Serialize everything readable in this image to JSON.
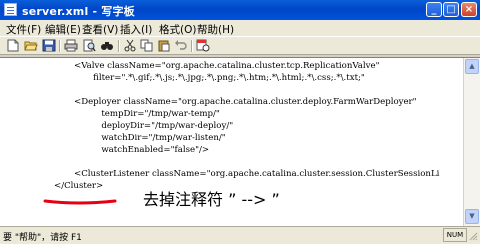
{
  "window": {
    "title": "server.xml - 写字板"
  },
  "titlebar_buttons": {
    "minimize": "_",
    "maximize": "□",
    "close": "×"
  },
  "menu": [
    "文件(F)",
    "编辑(E)",
    "查看(V)",
    "插入(I)",
    "格式(O)",
    "帮助(H)"
  ],
  "toolbar_icons": [
    "new-icon",
    "open-icon",
    "save-icon",
    "print-icon",
    "print-preview-icon",
    "find-icon",
    "cut-icon",
    "copy-icon",
    "paste-icon",
    "undo-icon",
    "date-time-icon"
  ],
  "document": {
    "lines": [
      "<Valve className=\"org.apache.catalina.cluster.tcp.ReplicationValve\"",
      "       filter=\".*\\.gif;.*\\.js;.*\\.jpg;.*\\.png;.*\\.htm;.*\\.html;.*\\.css;.*\\.txt;\"",
      "",
      "<Deployer className=\"org.apache.catalina.cluster.deploy.FarmWarDeployer\"",
      "          tempDir=\"/tmp/war-temp/\"",
      "          deployDir=\"/tmp/war-deploy/\"",
      "          watchDir=\"/tmp/war-listen/\"",
      "          watchEnabled=\"false\"/>",
      "",
      "",
      "<ClusterListener className=\"org.apache.catalina.cluster.session.ClusterSessionLi",
      "</Cluster>"
    ],
    "annotation": "去掉注释符 ” --> ”"
  },
  "scrollbar": {
    "up": "▲",
    "down": "▼"
  },
  "status": {
    "text": "要 \"帮助\"，请按 F1",
    "indicator": "NUM"
  },
  "colors": {
    "title_blue": "#0046c8",
    "annotation_red": "#e60012",
    "chrome": "#ece9d8"
  }
}
